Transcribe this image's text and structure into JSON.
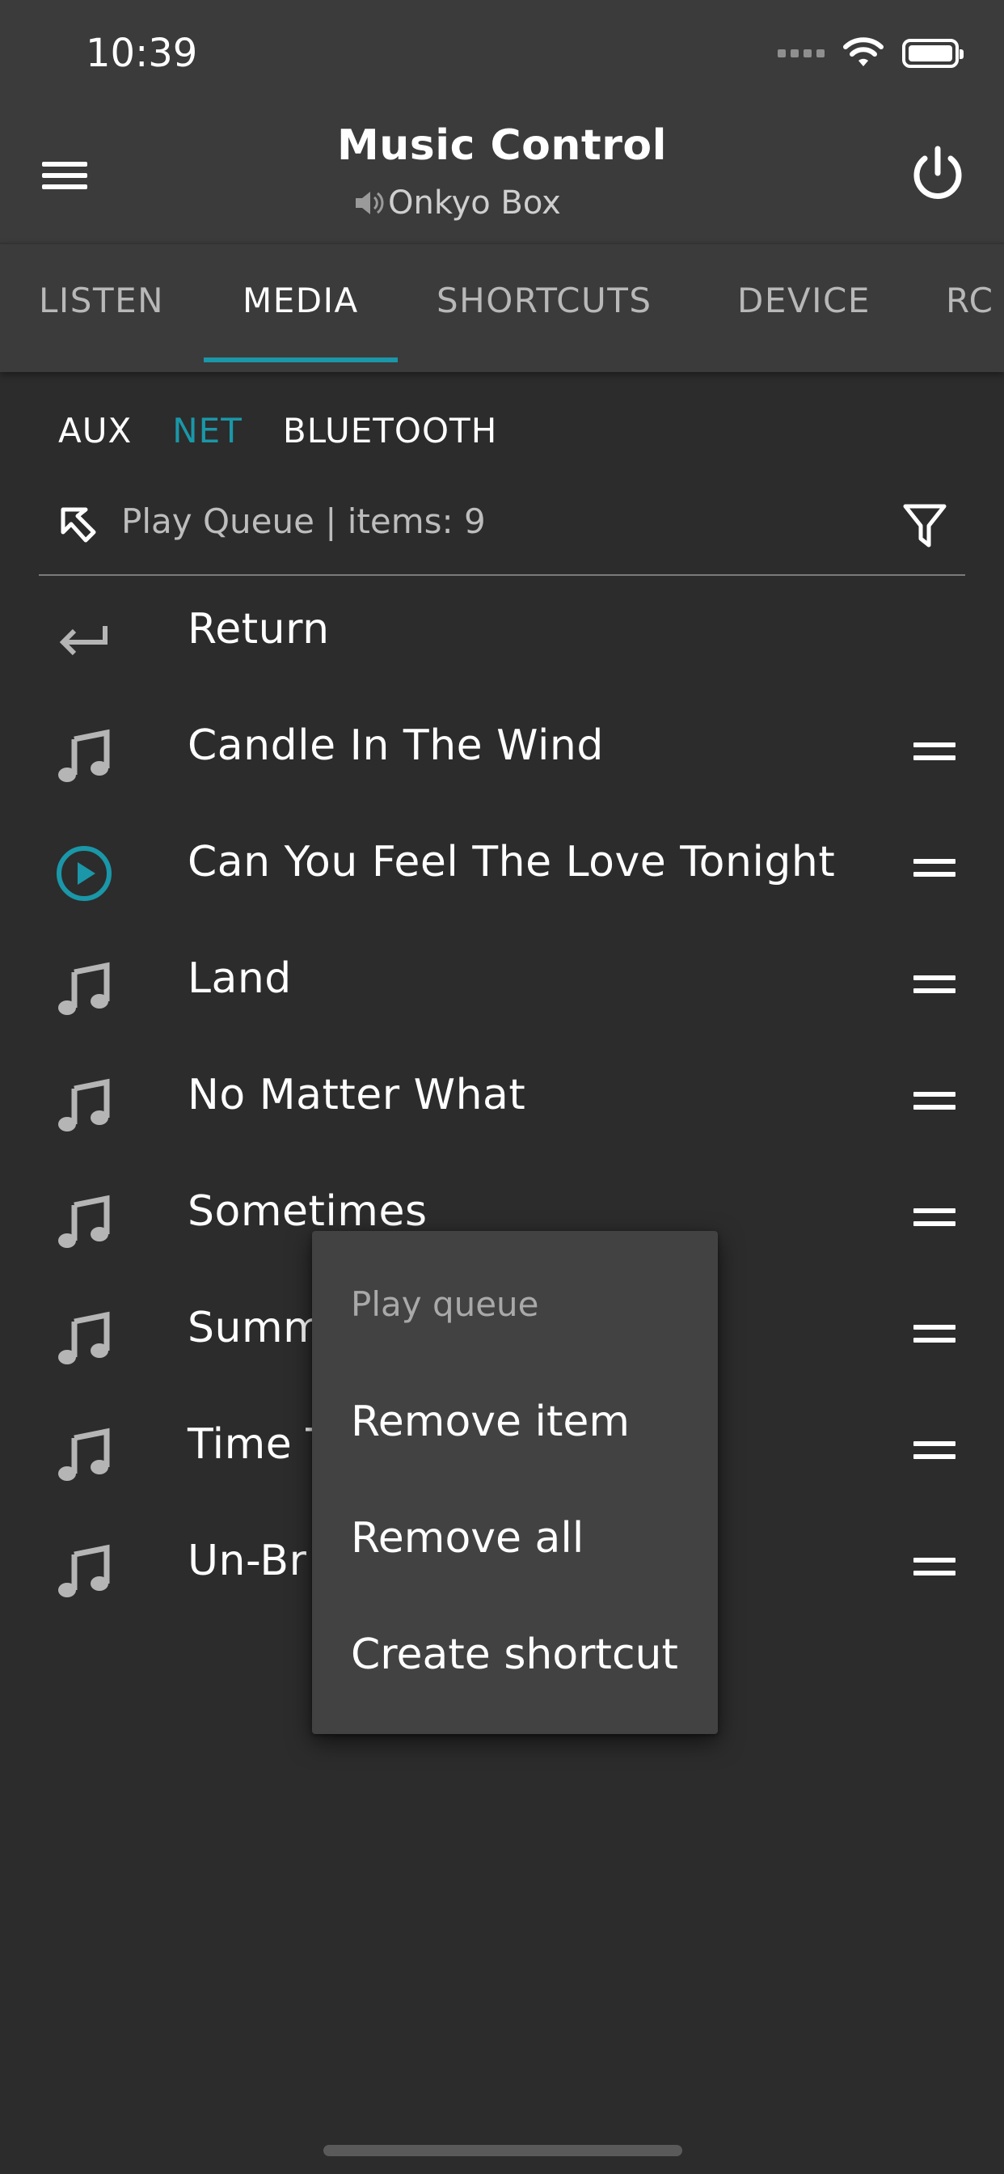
{
  "status_bar": {
    "time": "10:39"
  },
  "app_bar": {
    "title": "Music Control",
    "subtitle": "Onkyo Box"
  },
  "tabs": [
    {
      "label": "LISTEN",
      "active": false
    },
    {
      "label": "MEDIA",
      "active": true
    },
    {
      "label": "SHORTCUTS",
      "active": false
    },
    {
      "label": "DEVICE",
      "active": false
    },
    {
      "label": "RC",
      "active": false
    }
  ],
  "sources": [
    {
      "label": "AUX",
      "active": false
    },
    {
      "label": "NET",
      "active": true
    },
    {
      "label": "BLUETOOTH",
      "active": false
    }
  ],
  "queue": {
    "header": "Play Queue | items: 9"
  },
  "list": {
    "return_label": "Return",
    "items": [
      {
        "label": "Candle In The Wind",
        "icon": "music-note-icon"
      },
      {
        "label": "Can You Feel The Love Tonight",
        "icon": "play-circle-icon"
      },
      {
        "label": "Land",
        "icon": "music-note-icon"
      },
      {
        "label": "No Matter What",
        "icon": "music-note-icon"
      },
      {
        "label": "Sometimes",
        "icon": "music-note-icon"
      },
      {
        "label": "Summ",
        "icon": "music-note-icon"
      },
      {
        "label": "Time T",
        "icon": "music-note-icon"
      },
      {
        "label": "Un-Br",
        "icon": "music-note-icon"
      }
    ]
  },
  "context_menu": {
    "title": "Play queue",
    "items": [
      "Remove item",
      "Remove all",
      "Create shortcut"
    ]
  },
  "colors": {
    "accent": "#1a97a8",
    "background": "#2c2c2c",
    "bar": "#3b3b3b",
    "menu": "#424242"
  }
}
